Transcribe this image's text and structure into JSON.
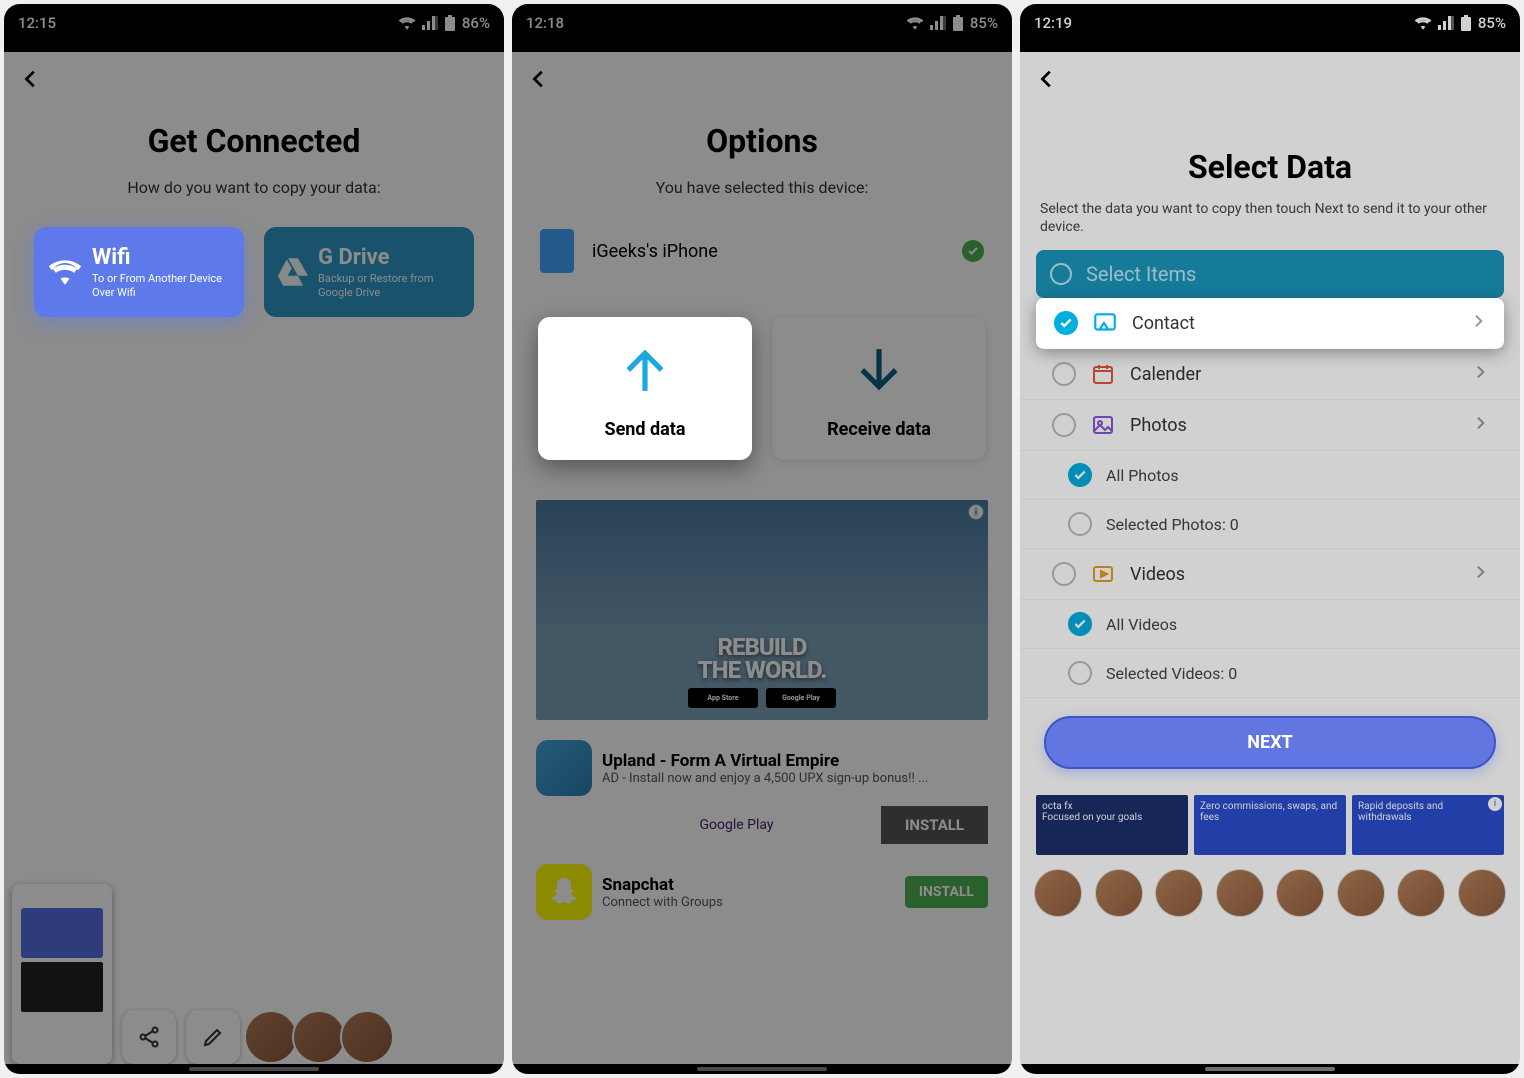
{
  "screen1": {
    "status": {
      "time": "12:15",
      "battery": "86%"
    },
    "title": "Get Connected",
    "subtitle": "How do you want to copy your data:",
    "wifi": {
      "title": "Wifi",
      "desc": "To or From Another Device Over Wifi"
    },
    "gdrive": {
      "title": "G Drive",
      "desc": "Backup or Restore from Google Drive"
    }
  },
  "screen2": {
    "status": {
      "time": "12:18",
      "battery": "85%"
    },
    "title": "Options",
    "subtitle": "You have selected this device:",
    "device_name": "iGeeks's iPhone",
    "send_label": "Send data",
    "receive_label": "Receive data",
    "ad_big_line1": "REBUILD",
    "ad_big_line2": "THE WORLD.",
    "ad_store1": "App Store",
    "ad_store2": "Google Play",
    "ad1_title": "Upland - Form A Virtual Empire",
    "ad1_desc": "AD - Install now and enjoy a 4,500 UPX sign-up bonus!! ...",
    "ad1_gp": "Google Play",
    "ad1_install": "INSTALL",
    "ad2_title": "Snapchat",
    "ad2_desc": "Connect with Groups",
    "ad2_install": "INSTALL"
  },
  "screen3": {
    "status": {
      "time": "12:19",
      "battery": "85%"
    },
    "title": "Select Data",
    "subtitle": "Select the data you want to copy then touch Next to send it to your other device.",
    "select_items": "Select Items",
    "items": {
      "contact": "Contact",
      "calendar": "Calender",
      "photos": "Photos",
      "all_photos": "All Photos",
      "sel_photos": "Selected Photos: 0",
      "videos": "Videos",
      "all_videos": "All Videos",
      "sel_videos": "Selected Videos: 0"
    },
    "next": "NEXT",
    "ad_tiles": {
      "t1a": "octa fx",
      "t1b": "Focused on your goals",
      "t2a": "Zero commissions, swaps, and fees",
      "t3a": "Rapid deposits and withdrawals"
    }
  }
}
